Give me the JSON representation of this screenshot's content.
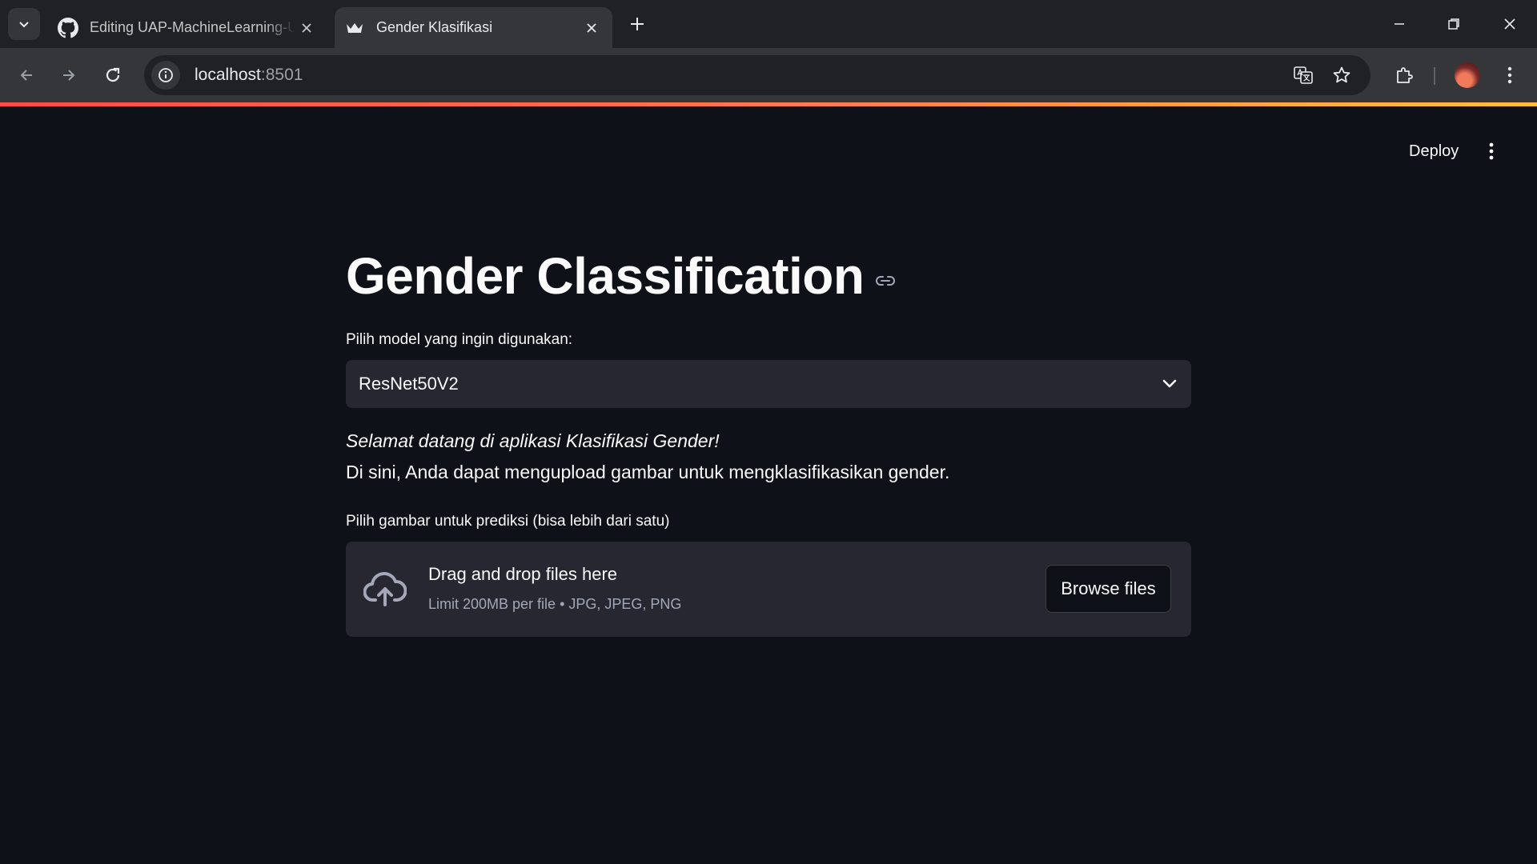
{
  "browser": {
    "tabs": [
      {
        "title": "Editing UAP-MachineLearning-UAP",
        "icon": "github-icon",
        "active": false
      },
      {
        "title": "Gender Klasifikasi",
        "icon": "streamlit-crown-icon",
        "active": true
      }
    ],
    "url": {
      "host": "localhost",
      "port": ":8501"
    }
  },
  "header": {
    "deploy_label": "Deploy"
  },
  "main": {
    "title": "Gender Classification",
    "model_select": {
      "label": "Pilih model yang ingin digunakan:",
      "value": "ResNet50V2"
    },
    "welcome": "Selamat datang di aplikasi Klasifikasi Gender!",
    "description": "Di sini, Anda dapat mengupload gambar untuk mengklasifikasikan gender.",
    "uploader": {
      "label": "Pilih gambar untuk prediksi (bisa lebih dari satu)",
      "drop_text": "Drag and drop files here",
      "limit_text": "Limit 200MB per file • JPG, JPEG, PNG",
      "browse_label": "Browse files"
    }
  },
  "colors": {
    "background": "#0e1117",
    "widget_bg": "#262730",
    "text": "#fafafa",
    "muted_text": "#a3a8b8",
    "accent": "#ff4b4b"
  }
}
